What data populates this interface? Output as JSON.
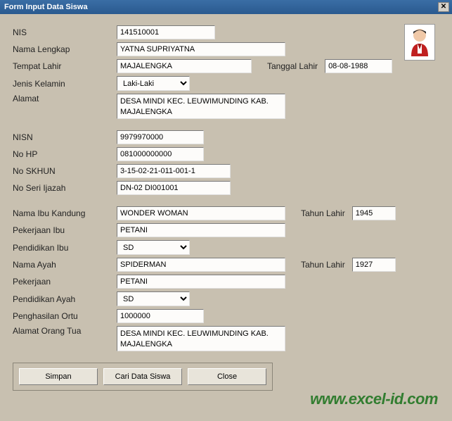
{
  "window": {
    "title": "Form Input Data Siswa",
    "close_glyph": "✕"
  },
  "labels": {
    "nis": "NIS",
    "nama_lengkap": "Nama Lengkap",
    "tempat_lahir": "Tempat Lahir",
    "tanggal_lahir": "Tanggal Lahir",
    "jenis_kelamin": "Jenis Kelamin",
    "alamat": "Alamat",
    "nisn": "NISN",
    "no_hp": "No HP",
    "no_skhun": "No SKHUN",
    "no_seri_ijazah": "No Seri Ijazah",
    "nama_ibu": "Nama Ibu Kandung",
    "tahun_lahir": "Tahun Lahir",
    "pekerjaan_ibu": "Pekerjaan Ibu",
    "pendidikan_ibu": "Pendidikan Ibu",
    "nama_ayah": "Nama Ayah",
    "pekerjaan": "Pekerjaan",
    "pendidikan_ayah": "Pendidikan Ayah",
    "penghasilan_ortu": "Penghasilan Ortu",
    "alamat_ortu": "Alamat Orang Tua"
  },
  "values": {
    "nis": "141510001",
    "nama_lengkap": "YATNA SUPRIYATNA",
    "tempat_lahir": "MAJALENGKA",
    "tanggal_lahir": "08-08-1988",
    "jenis_kelamin": "Laki-Laki",
    "alamat": "DESA MINDI KEC. LEUWIMUNDING KAB. MAJALENGKA",
    "nisn": "9979970000",
    "no_hp": "081000000000",
    "no_skhun": "3-15-02-21-011-001-1",
    "no_seri_ijazah": "DN-02 DI001001",
    "nama_ibu": "WONDER WOMAN",
    "tahun_lahir_ibu": "1945",
    "pekerjaan_ibu": "PETANI",
    "pendidikan_ibu": "SD",
    "nama_ayah": "SPIDERMAN",
    "tahun_lahir_ayah": "1927",
    "pekerjaan_ayah": "PETANI",
    "pendidikan_ayah": "SD",
    "penghasilan_ortu": "1000000",
    "alamat_ortu": "DESA MINDI KEC. LEUWIMUNDING KAB. MAJALENGKA"
  },
  "buttons": {
    "simpan": "Simpan",
    "cari": "Cari Data Siswa",
    "close": "Close"
  },
  "watermark": "www.excel-id.com"
}
